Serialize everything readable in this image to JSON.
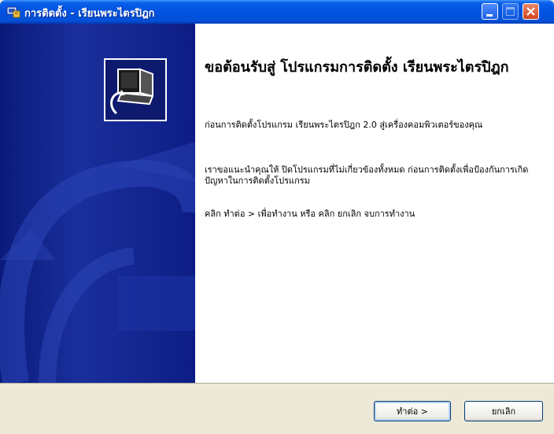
{
  "window": {
    "title": "การติดตั้ง - เรียนพระไตรปิฎก"
  },
  "content": {
    "heading": "ขอต้อนรับสู่ โปรแกรมการติดตั้ง เรียนพระไตรปิฎก",
    "paragraphs": [
      "ก่อนการติดตั้งโปรแกรม เรียนพระไตรปิฎก 2.0 สู่เครื่องคอมพิวเตอร์ของคุณ",
      "เราขอแนะนำคุณให้ ปิดโปรแกรมที่ไม่เกี่ยวข้องทั้งหมด ก่อนการติดตั้งเพื่อป้องกันการเกิดปัญหาในการติดตั้งโปรแกรม",
      "คลิก ทำต่อ > เพื่อทำงาน หรือ คลิก ยกเลิก จบการทำงาน"
    ]
  },
  "buttons": {
    "next": "ทำต่อ >",
    "cancel": "ยกเลิก"
  },
  "colors": {
    "titlebar": "#0052e0",
    "side_panel": "#0a1a7a",
    "dialog_bg": "#ECE9D8"
  },
  "icons": {
    "app": "installer-icon",
    "side": "computer-install-icon"
  }
}
